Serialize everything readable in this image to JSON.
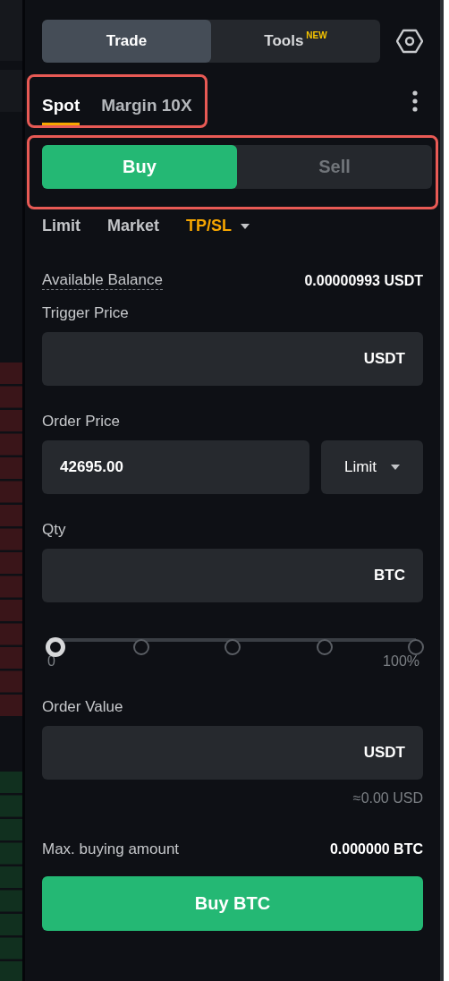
{
  "top_tabs": [
    {
      "label": "Trade",
      "selected": true
    },
    {
      "label": "Tools",
      "badge": "NEW",
      "selected": false
    }
  ],
  "mode_tabs": {
    "annotated": true,
    "items": [
      {
        "label": "Spot",
        "selected": true
      },
      {
        "label": "Margin 10X",
        "selected": false
      }
    ]
  },
  "side_toggle": {
    "annotated": true,
    "items": [
      {
        "label": "Buy",
        "selected": true
      },
      {
        "label": "Sell",
        "selected": false
      }
    ]
  },
  "order_types": [
    {
      "label": "Limit",
      "selected": false,
      "dropdown": false
    },
    {
      "label": "Market",
      "selected": false,
      "dropdown": false
    },
    {
      "label": "TP/SL",
      "selected": true,
      "dropdown": true
    }
  ],
  "balance": {
    "label": "Available Balance",
    "value": "0.00000993 USDT"
  },
  "trigger_price": {
    "label": "Trigger Price",
    "unit": "USDT"
  },
  "order_price": {
    "label": "Order Price",
    "value": "42695.00",
    "type": "Limit"
  },
  "qty": {
    "label": "Qty",
    "unit": "BTC"
  },
  "slider": {
    "level": 0,
    "min_label": "0",
    "max_label": "100%"
  },
  "order_value": {
    "label": "Order Value",
    "unit": "USDT",
    "estimate": "≈0.00 USD"
  },
  "max_buy": {
    "label": "Max. buying amount",
    "value": "0.000000 BTC"
  },
  "submit": "Buy BTC"
}
